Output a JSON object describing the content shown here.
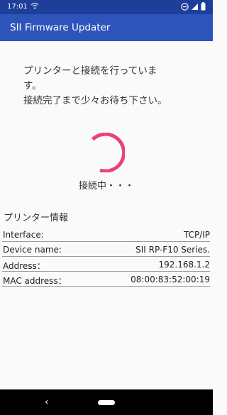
{
  "status_bar": {
    "time": "17:01"
  },
  "app_bar": {
    "title": "SII Firmware Updater"
  },
  "message": "プリンターと接続を行っていま\nす。\n接続完了まで少々お待ち下さい。",
  "connecting_text": "接続中・・・",
  "printer_info": {
    "title": "プリンター情報",
    "rows": [
      {
        "label": "Interface:",
        "value": "TCP/IP"
      },
      {
        "label": "Device name:",
        "value": "SII RP-F10 Series."
      },
      {
        "label": "Address：",
        "value": "192.168.1.2"
      },
      {
        "label": "MAC address：",
        "value": "08:00:83:52:00:19"
      }
    ]
  },
  "colors": {
    "status_bar": "#1e3f99",
    "app_bar": "#2d54ba",
    "spinner": "#e9417f",
    "nav_bar": "#000000"
  },
  "icons": [
    "wifi-icon",
    "dnd-icon",
    "signal-icon",
    "battery-icon",
    "back-icon",
    "home-pill-icon"
  ]
}
